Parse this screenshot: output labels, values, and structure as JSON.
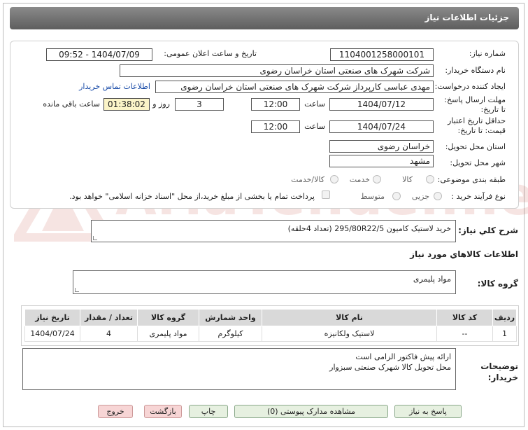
{
  "header": {
    "title": "جزئیات اطلاعات نیاز"
  },
  "watermark": {
    "text": "AriaTender.neT"
  },
  "need": {
    "number_label": "شماره نیاز:",
    "number": "1104001258000101",
    "announce_label": "تاریخ و ساعت اعلان عمومی:",
    "announce_value": "1404/07/09 - 09:52",
    "buyer_label": "نام دستگاه خریدار:",
    "buyer": "شرکت شهرک های صنعتی استان خراسان رضوی",
    "creator_label": "ایجاد کننده درخواست:",
    "creator": "مهدی عباسی کارپرداز شرکت شهرک های صنعتی استان خراسان رضوی",
    "contact_link": "اطلاعات تماس خریدار",
    "deadline_label": "مهلت ارسال پاسخ: تا تاریخ:",
    "deadline_date": "1404/07/12",
    "time_label": "ساعت",
    "deadline_time": "12:00",
    "days_value": "3",
    "days_label": "روز و",
    "timer": "01:38:02",
    "remaining_label": "ساعت باقی مانده",
    "validity_label": "حداقل تاریخ اعتبار قیمت: تا تاریخ:",
    "validity_date": "1404/07/24",
    "validity_time_label": "ساعت",
    "validity_time": "12:00",
    "province_label": "استان محل تحویل:",
    "province": "خراسان رضوی",
    "city_label": "شهر محل تحویل:",
    "city": "مشهد",
    "category_label": "طبقه بندی موضوعی:",
    "category_options": [
      "کالا",
      "خدمت",
      "کالا/خدمت"
    ],
    "process_label": "نوع فرآیند خرید :",
    "process_options": [
      "جزیی",
      "متوسط"
    ],
    "payment_note": "پرداخت تمام یا بخشی از مبلغ خرید،از محل \"اسناد خزانه اسلامی\" خواهد بود."
  },
  "summary": {
    "label": "شرح کلي نياز:",
    "text": "خرید لاستیک کامیون 295/80R22/5    (تعداد 4حلقه)"
  },
  "goods_info": {
    "title": "اطلاعات کالاهاي مورد نياز",
    "group_label": "گروه کالا:",
    "group_value": "مواد پلیمری"
  },
  "table": {
    "headers": [
      "ردیف",
      "کد کالا",
      "نام کالا",
      "واحد شمارش",
      "گروه کالا",
      "تعداد / مقدار",
      "تاریخ نیاز"
    ],
    "rows": [
      [
        "1",
        "--",
        "لاستیک ولکانیزه",
        "کیلوگرم",
        "مواد پلیمری",
        "4",
        "1404/07/24"
      ]
    ]
  },
  "buyer_notes": {
    "label": "توضیحات خریدار:",
    "line1": "ارائه پیش فاکتور الزامی است",
    "line2": "محل تحویل کالا شهرک صنعتی سبزوار"
  },
  "buttons": {
    "reply": "پاسخ به نیاز",
    "view_docs": "مشاهده مدارک پیوستی (0)",
    "print": "چاپ",
    "back": "بازگشت",
    "exit": "خروج"
  }
}
